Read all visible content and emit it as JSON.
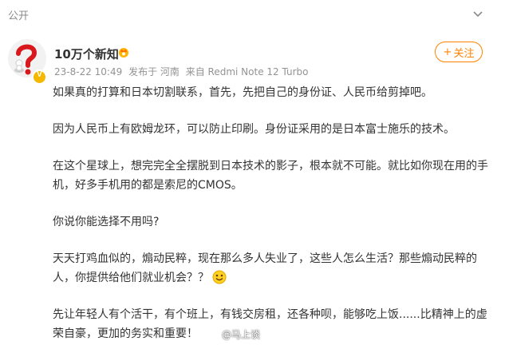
{
  "header": {
    "visibility": "公开",
    "menu_icon": "chevron-down-icon"
  },
  "author": {
    "name": "10万个新知",
    "avatar_icon": "question-mark-figure-icon",
    "verified_badge": "V",
    "level_icon": "crown-badge-icon"
  },
  "meta": {
    "time": "23-8-22 10:49",
    "location": "发布于 河南",
    "device": "来自 Redmi Note 12 Turbo"
  },
  "follow_button": {
    "plus": "+",
    "label": "关注"
  },
  "post": {
    "p1": "如果真的打算和日本切割联系，首先，先把自己的身份证、人民币给剪掉吧。",
    "p2": "因为人民币上有欧姆龙环，可以防止印刷。身份证采用的是日本富士施乐的技术。",
    "p3": "在这个星球上，想完完全全摆脱到日本技术的影子，根本就不可能。就比如你现在用的手机，好多手机用的都是索尼的CMOS。",
    "p4": "你说你能选择不用吗?",
    "p5": "天天打鸡血似的，煽动民粹，现在那么多人失业了，这些人怎么生活？那些煽动民粹的人，你提供给他们就业机会？？",
    "p6": "先让年轻人有个活干，有个班上，有钱交房租，还各种呗，能够吃上饭......比精神上的虚荣自豪，更加的务实和重要！"
  },
  "watermark": "@马上谈",
  "colors": {
    "accent": "#ff8200",
    "meta": "#939393",
    "text": "#333333"
  }
}
